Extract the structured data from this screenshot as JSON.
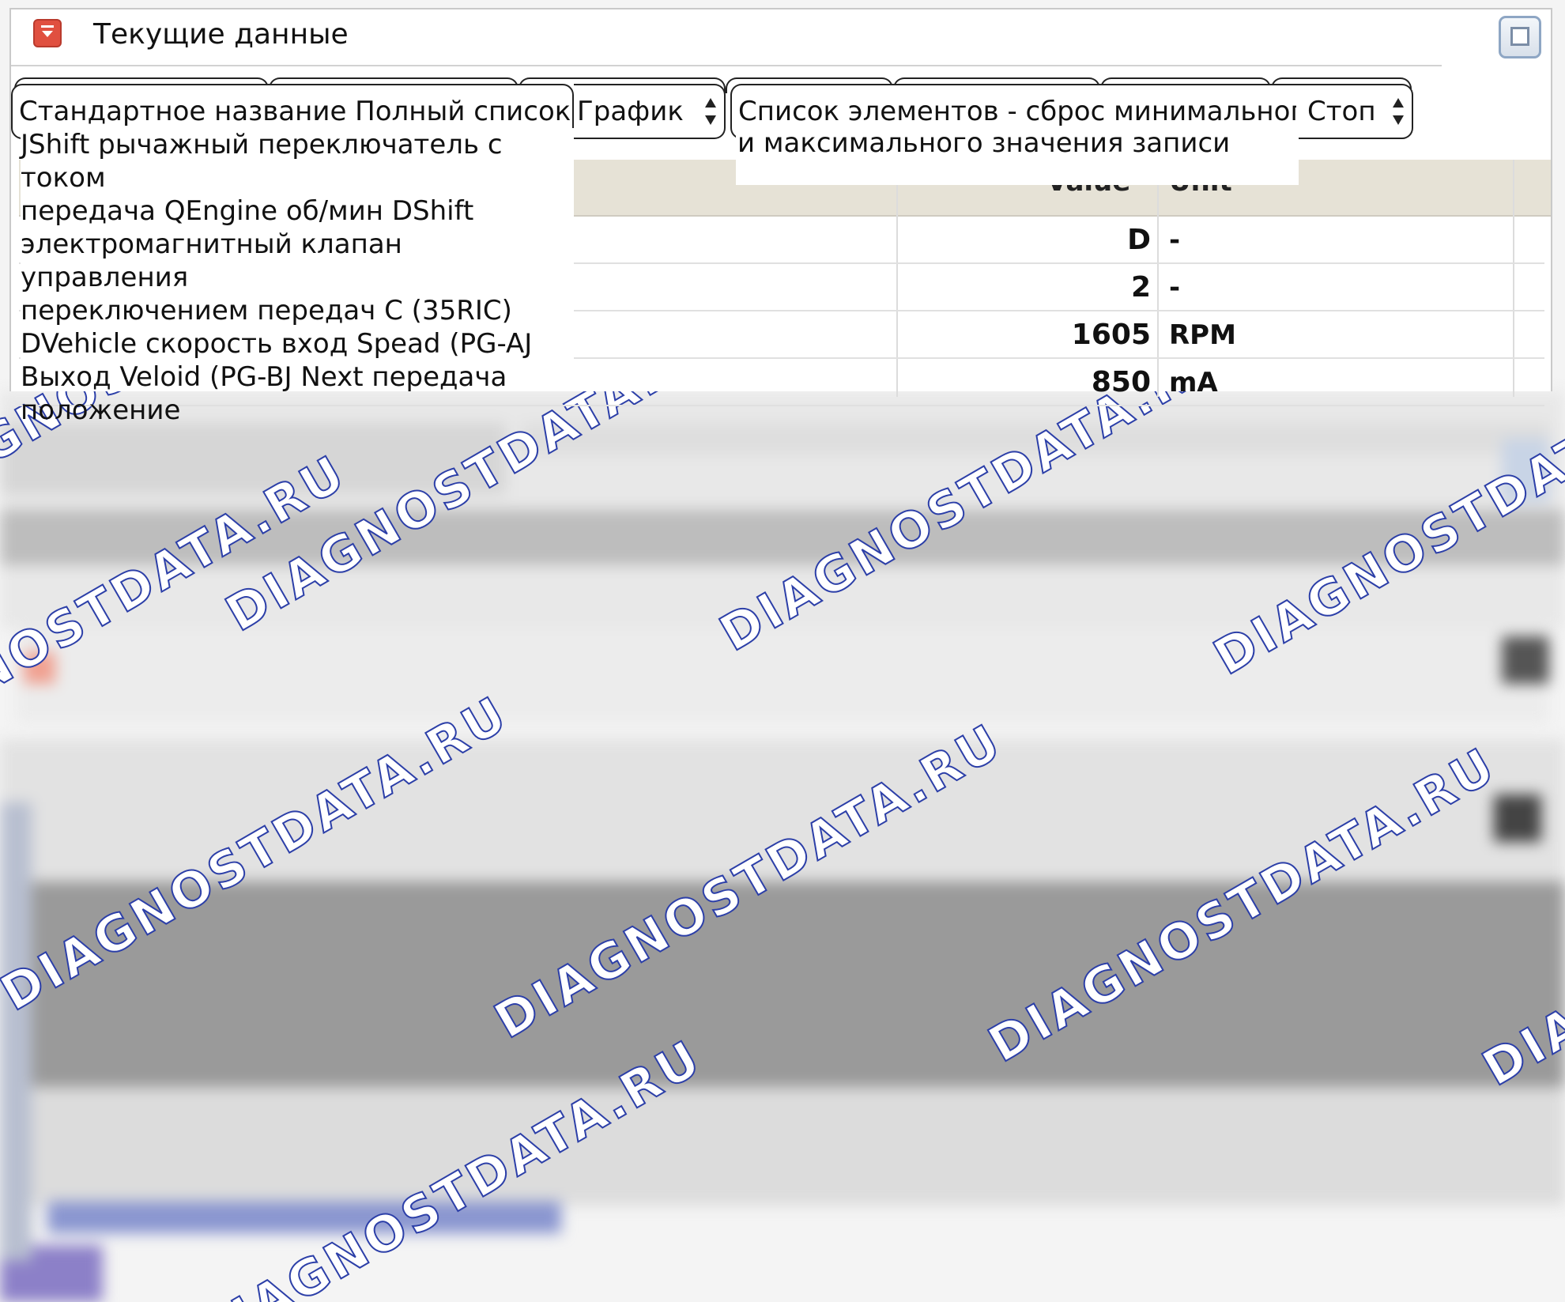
{
  "window": {
    "title": "Текущие данные"
  },
  "controls": {
    "name_selector": "Стандартное название Полный список я",
    "chart_button": "График",
    "reset_button": "Список элементов - сброс минимального",
    "stop_button": "Стоп"
  },
  "dropdown": {
    "lines": [
      "JShift рычажный переключатель с током",
      "передача QEngine об/мин DShift",
      "электромагнитный клапан управления",
      "переключением передач С (35RIC)",
      "DVehicle скорость вход Spead (PG-AJ",
      "Выход Veloid (PG-BJ Next передача",
      "положение"
    ]
  },
  "reset_menu": {
    "lines": [
      "и максимального значения записи"
    ]
  },
  "table": {
    "columns": [
      "Value",
      "Unit"
    ],
    "rows": [
      {
        "value": "D",
        "unit": "-"
      },
      {
        "value": "2",
        "unit": "-"
      },
      {
        "value": "1605",
        "unit": "RPM"
      },
      {
        "value": "850",
        "unit": "mA"
      }
    ]
  },
  "watermark": {
    "text": "DIAGNOSTDATA.RU"
  }
}
